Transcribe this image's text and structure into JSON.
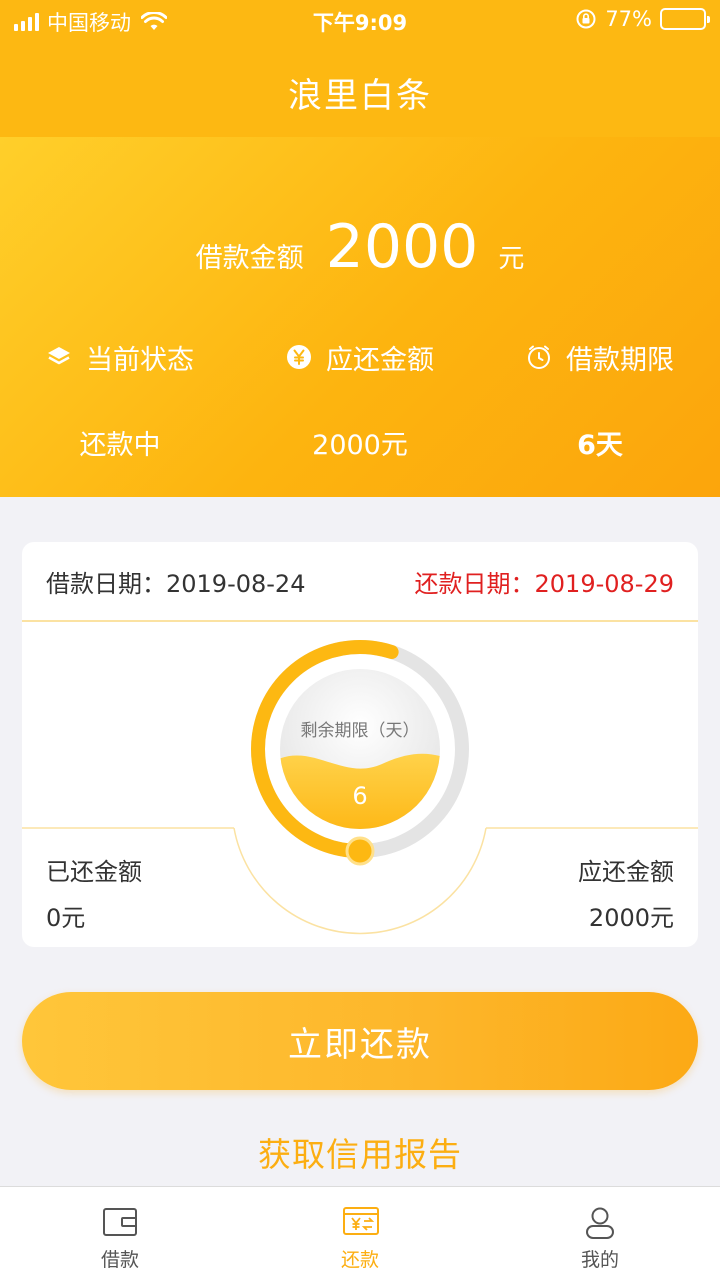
{
  "status_bar": {
    "carrier": "中国移动",
    "time": "下午9:09",
    "battery_text": "77%",
    "battery_level": 0.77
  },
  "nav": {
    "title": "浪里白条"
  },
  "hero": {
    "amount_label": "借款金额",
    "amount": "2000",
    "unit": "元",
    "stats": [
      {
        "label": "当前状态",
        "value": "还款中",
        "icon": "layers-icon"
      },
      {
        "label": "应还金额",
        "value": "2000元",
        "icon": "yen-coin-icon"
      },
      {
        "label": "借款期限",
        "value": "6天",
        "icon": "clock-icon"
      }
    ]
  },
  "card": {
    "borrow_date": "借款日期：2019-08-24",
    "repay_date": "还款日期：2019-08-29",
    "gauge_label": "剩余期限（天）",
    "remaining_days": "6",
    "remaining_fraction": 0.55,
    "paid_label": "已还金额",
    "paid_value": "0元",
    "due_label": "应还金额",
    "due_value": "2000元"
  },
  "actions": {
    "repay_button": "立即还款",
    "credit_report": "获取信用报告"
  },
  "tabs": [
    {
      "label": "借款",
      "icon": "wallet-icon",
      "active": false
    },
    {
      "label": "还款",
      "icon": "repay-bill-icon",
      "active": true
    },
    {
      "label": "我的",
      "icon": "user-icon",
      "active": false
    }
  ],
  "colors": {
    "brand": "#fdb812",
    "accent_text": "#fcae12",
    "alert": "#e02020"
  }
}
